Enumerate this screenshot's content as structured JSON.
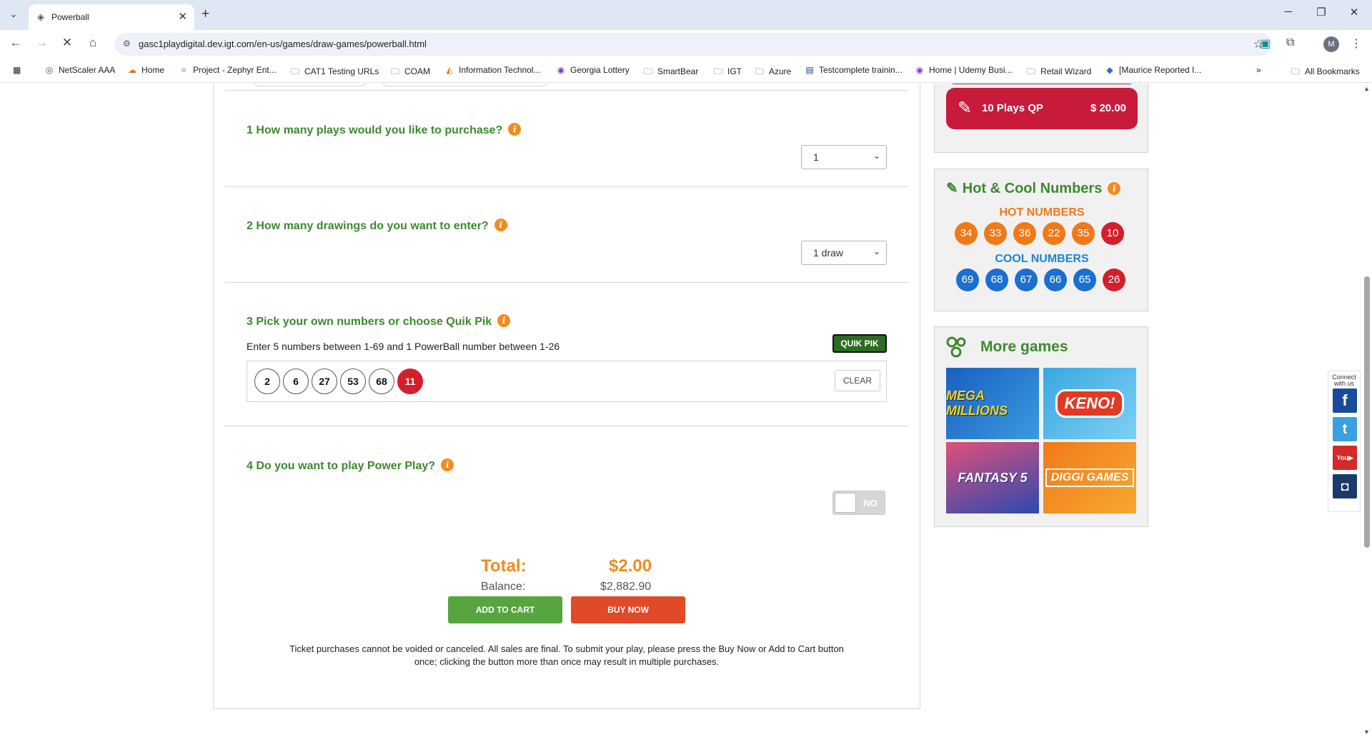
{
  "browser": {
    "tab_title": "Powerball",
    "url": "gasc1playdigital.dev.igt.com/en-us/games/draw-games/powerball.html",
    "profile_initial": "M",
    "bookmarks": [
      {
        "label": "NetScaler AAA",
        "icon": "globe-icon"
      },
      {
        "label": "Home",
        "icon": "home-icon"
      },
      {
        "label": "Project - Zephyr Ent...",
        "icon": "zephyr-icon"
      },
      {
        "label": "CAT1 Testing URLs",
        "icon": "folder-icon"
      },
      {
        "label": "COAM",
        "icon": "folder-icon"
      },
      {
        "label": "Information Technol...",
        "icon": "site-icon"
      },
      {
        "label": "Georgia Lottery",
        "icon": "site-icon"
      },
      {
        "label": "SmartBear",
        "icon": "folder-icon"
      },
      {
        "label": "IGT",
        "icon": "folder-icon"
      },
      {
        "label": "Azure",
        "icon": "folder-icon"
      },
      {
        "label": "Testcomplete trainin...",
        "icon": "tm-icon"
      },
      {
        "label": "Home | Udemy Busi...",
        "icon": "udemy-icon"
      },
      {
        "label": "Retail Wizard",
        "icon": "folder-icon"
      },
      {
        "label": "[Maurice Reported I...",
        "icon": "jira-icon"
      }
    ],
    "all_bookmarks": "All Bookmarks"
  },
  "steps": {
    "s1": "1 How many plays would you like to purchase?",
    "s1_value": "1",
    "s2": "2 How many drawings do you want to enter?",
    "s2_value": "1 draw",
    "s3": "3 Pick your own numbers or choose Quik Pik",
    "s3_instr": "Enter 5 numbers between 1-69 and 1 PowerBall number between 1-26",
    "quikpik": "QUIK PIK",
    "picked": [
      "2",
      "6",
      "27",
      "53",
      "68"
    ],
    "powerball": "11",
    "clear": "CLEAR",
    "s4": "4 Do you want to play Power Play?",
    "powerplay": "NO"
  },
  "totals": {
    "total_label": "Total:",
    "total_value": "$2.00",
    "balance_label": "Balance:",
    "balance_value": "$2,882.90",
    "add_to_cart": "ADD TO CART",
    "buy_now": "BUY NOW",
    "disclaimer": "Ticket purchases cannot be voided or canceled. All sales are final. To submit your play, please press the Buy Now or Add to Cart button once; clicking the button more than once may result in multiple purchases."
  },
  "sidebar": {
    "qp_label": "10 Plays QP",
    "qp_price": "$ 20.00",
    "hc_title": "Hot & Cool Numbers",
    "hot_label": "HOT NUMBERS",
    "hot": [
      "34",
      "33",
      "36",
      "22",
      "35"
    ],
    "hot_pb": "10",
    "cool_label": "COOL NUMBERS",
    "cool": [
      "69",
      "68",
      "67",
      "66",
      "65"
    ],
    "cool_pb": "26",
    "more_games": "More games",
    "games": [
      "MEGA MILLIONS",
      "KENO!",
      "FANTASY 5",
      "DIGGI GAMES"
    ]
  },
  "social": {
    "caption": "Connect with us",
    "icons": [
      "facebook-icon",
      "twitter-icon",
      "youtube-icon",
      "instagram-icon"
    ]
  },
  "colors": {
    "green_title": "#3c8a2e",
    "orange": "#f08c1a",
    "red": "#d41f2a",
    "blue": "#1a6fd0"
  }
}
